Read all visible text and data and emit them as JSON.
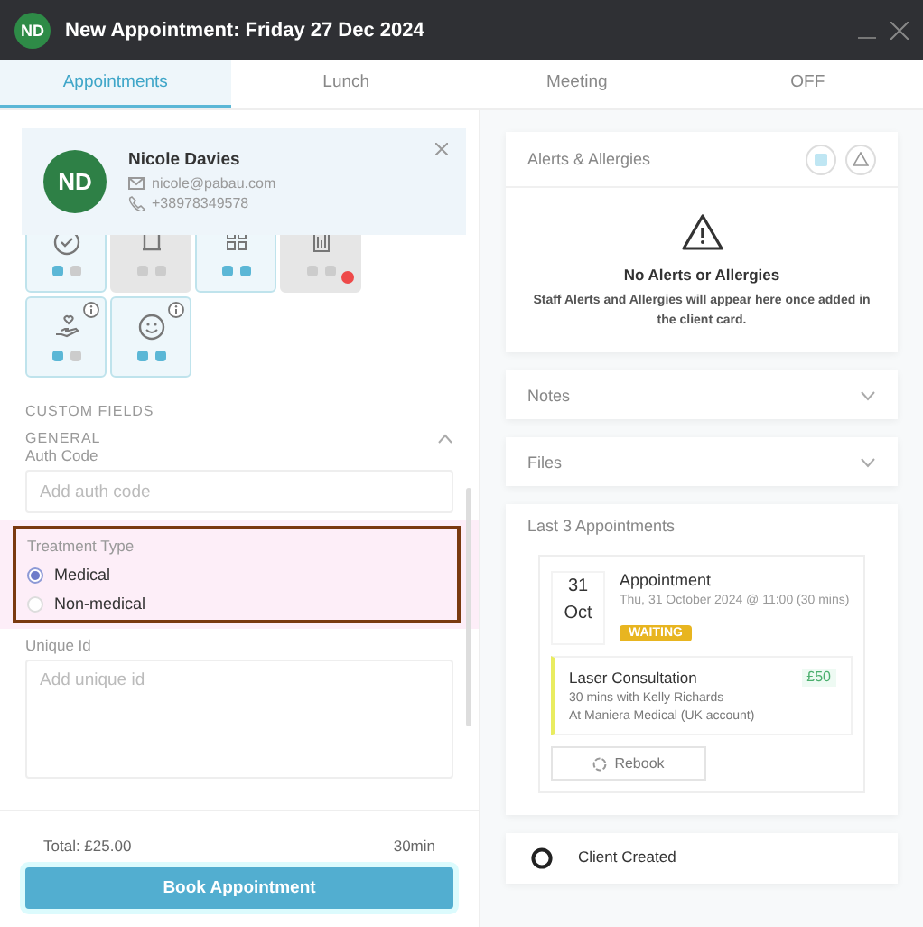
{
  "window": {
    "title": "New Appointment: Friday 27 Dec 2024",
    "avatar": "ND"
  },
  "tabs": [
    {
      "label": "Appointments",
      "selected": true
    },
    {
      "label": "Lunch",
      "selected": false
    },
    {
      "label": "Meeting",
      "selected": false
    },
    {
      "label": "OFF",
      "selected": false
    }
  ],
  "client": {
    "initials": "ND",
    "name": "Nicole Davies",
    "email": "nicole@pabau.com",
    "phone": "+38978349578"
  },
  "tiles": [
    {
      "active": true,
      "info": false,
      "alert": false,
      "flags": [
        {
          "on": true
        },
        {
          "on": false
        }
      ]
    },
    {
      "active": false,
      "info": false,
      "alert": false,
      "flags": [
        {
          "on": false
        },
        {
          "on": false
        }
      ]
    },
    {
      "active": true,
      "info": false,
      "alert": false,
      "flags": [
        {
          "on": true
        },
        {
          "on": true
        }
      ]
    },
    {
      "active": false,
      "info": false,
      "alert": true,
      "flags": [
        {
          "on": false
        },
        {
          "on": false
        }
      ]
    },
    {
      "active": true,
      "info": true,
      "alert": false,
      "flags": [
        {
          "on": true
        },
        {
          "on": false
        }
      ]
    },
    {
      "active": true,
      "info": true,
      "alert": false,
      "flags": [
        {
          "on": true
        },
        {
          "on": true
        }
      ]
    }
  ],
  "custom_fields": {
    "heading": "CUSTOM FIELDS",
    "group": "GENERAL",
    "expanded": true,
    "fields": [
      {
        "kind": "text",
        "label": "Auth Code",
        "placeholder": "Add auth code"
      },
      {
        "kind": "radio",
        "label": "Treatment Type",
        "highlighted": true,
        "options": [
          {
            "label": "Medical",
            "selected": true
          },
          {
            "label": "Non-medical",
            "selected": false
          }
        ]
      },
      {
        "kind": "textarea",
        "label": "Unique Id",
        "placeholder": "Add unique id"
      }
    ]
  },
  "footer": {
    "total": "Total: £25.00",
    "duration": "30min",
    "button": "Book Appointment"
  },
  "alerts": {
    "title": "Alerts & Allergies",
    "empty_title": "No Alerts or Allergies",
    "empty_text": "Staff Alerts and Allergies will appear here once added in the client card."
  },
  "sections": [
    {
      "title": "Notes",
      "expanded": false
    },
    {
      "title": "Files",
      "expanded": false
    }
  ],
  "last_appointments": {
    "title": "Last 3 Appointments",
    "items": [
      {
        "day": "31",
        "month": "Oct",
        "title": "Appointment",
        "when": "Thu, 31 October 2024 @ 11:00 (30 mins)",
        "status": "WAITING",
        "service": "Laser Consultation",
        "price": "£50",
        "details": "30 mins with Kelly Richards",
        "location": "At Maniera Medical (UK account)",
        "action": "Rebook"
      }
    ]
  },
  "timeline": [
    {
      "title": "Client Created"
    }
  ]
}
